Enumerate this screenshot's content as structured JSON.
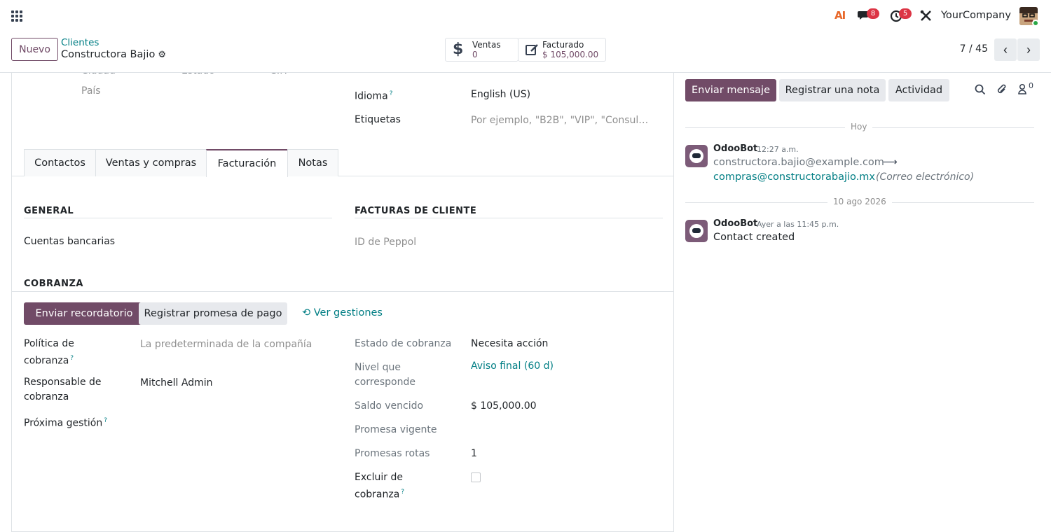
{
  "navbar": {
    "ai_label": "AI",
    "messages_count": "8",
    "activities_count": "5",
    "company": "YourCompany"
  },
  "control": {
    "new_label": "Nuevo",
    "breadcrumb": "Clientes",
    "record_name": "Constructora Bajio",
    "smart_buttons": [
      {
        "label": "Ventas",
        "value": "0",
        "icon": "dollar-icon"
      },
      {
        "label": "Facturado",
        "value": "$ 105,000.00",
        "icon": "edit-icon"
      }
    ],
    "pager": "7 / 45"
  },
  "form": {
    "top_cut_labels": [
      "Ciudad",
      "Estado",
      "C.P."
    ],
    "country_placeholder": "País",
    "language_label": "Idioma",
    "language_value": "English (US)",
    "tags_label": "Etiquetas",
    "tags_placeholder": "Por ejemplo, \"B2B\", \"VIP\", \"Consul…",
    "tabs": [
      "Contactos",
      "Ventas y compras",
      "Facturación",
      "Notas"
    ],
    "general_title": "GENERAL",
    "bank_accounts": "Cuentas bancarias",
    "customer_invoices_title": "FACTURAS DE CLIENTE",
    "peppol_id": "ID de Peppol",
    "collection_title": "COBRANZA",
    "send_reminder": "Enviar recordatorio",
    "register_promise": "Registrar promesa de pago",
    "view_actions": "Ver gestiones",
    "collection_policy_label": "Política de cobranza",
    "collection_policy_value": "La predeterminada de la compañía",
    "collection_responsible_label": "Responsable de cobranza",
    "collection_responsible_value": "Mitchell Admin",
    "next_action_label": "Próxima gestión",
    "collection_status_label": "Estado de cobranza",
    "collection_status_value": "Necesita acción",
    "level_label": "Nivel que corresponde",
    "level_value": "Aviso final (60 d)",
    "overdue_label": "Saldo vencido",
    "overdue_value": "$ 105,000.00",
    "active_promise_label": "Promesa vigente",
    "broken_promises_label": "Promesas rotas",
    "broken_promises_value": "1",
    "exclude_label": "Excluir de cobranza",
    "exclude_checked": false
  },
  "chatter": {
    "send_message": "Enviar mensaje",
    "log_note": "Registrar una nota",
    "activity": "Actividad",
    "followers_count": "0",
    "messages": [
      {
        "separator": "Hoy",
        "author": "OdooBot",
        "time": "12:27 a.m.",
        "old_value": "constructora.bajio@example.com",
        "arrow": "⟶",
        "new_value": "compras@constructorabajio.mx",
        "field": "(Correo electrónico)"
      },
      {
        "separator": "10 ago 2026",
        "author": "OdooBot",
        "time": "Ayer a las 11:45 p.m.",
        "body": "Contact created"
      }
    ]
  }
}
